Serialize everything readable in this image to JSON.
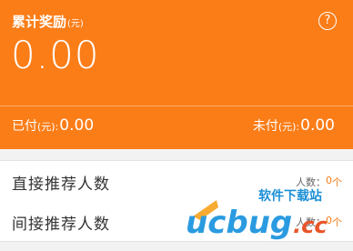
{
  "header": {
    "title": "累计奖励",
    "title_unit": "(元)",
    "help_symbol": "?",
    "total": "0.00",
    "paid_label": "已付",
    "paid_unit": "(元):",
    "paid_value": "0.00",
    "unpaid_label": "未付",
    "unpaid_unit": "(元):",
    "unpaid_value": "0.00",
    "accent": "#fb7d18"
  },
  "rows": [
    {
      "label": "直接推荐人数",
      "count_label": "人数：",
      "count": "0",
      "count_unit": "个"
    },
    {
      "label": "间接推荐人数",
      "count_label": "人数：",
      "count": "0",
      "count_unit": "个"
    }
  ],
  "watermark": {
    "brand": "ucbug",
    "domain": ".cc",
    "tagline": "软件下载站"
  }
}
